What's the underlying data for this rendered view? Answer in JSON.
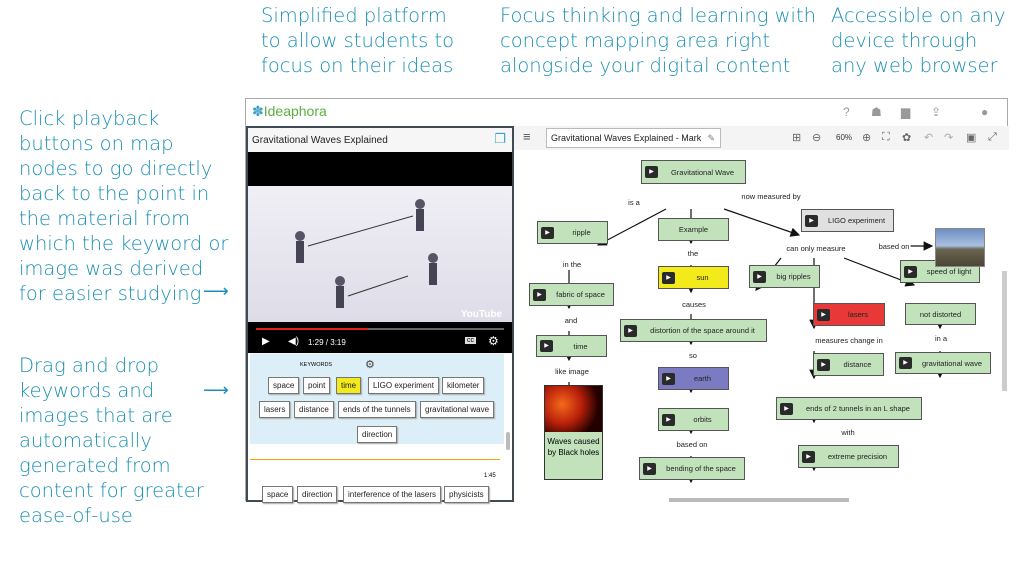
{
  "captions": {
    "top": [
      [
        "Simplified platform",
        "to allow students to",
        "focus on their ideas"
      ],
      [
        "Focus thinking and learning with",
        "concept mapping area right",
        "alongside your digital content"
      ],
      [
        "Accessible on any",
        "device through",
        "any web browser"
      ]
    ],
    "left": [
      [
        "Click playback",
        "buttons on map",
        "nodes to go directly",
        "back to the point in",
        "the material from",
        "which the keyword or",
        "image was derived",
        "for easier studying"
      ],
      [
        "Drag and drop",
        "keywords and",
        "images that are",
        "automatically",
        "generated from",
        "content for greater",
        "ease-of-use"
      ]
    ]
  },
  "app": {
    "logo": "Ideaphora",
    "top_icons": [
      "help-icon",
      "hierarchy-icon",
      "folder-icon",
      "upload-icon",
      "user-icon"
    ]
  },
  "left_panel": {
    "title": "Gravitational Waves Explained",
    "video": {
      "time": "1:29 / 3:19",
      "progress_percent": 45,
      "watermark": "YouTube"
    },
    "keywords_label": "KEYWORDS",
    "keywords": [
      "space",
      "point",
      "time",
      "LIGO experiment",
      "kilometer",
      "lasers",
      "distance",
      "ends of the tunnels",
      "gravitational wave",
      "direction"
    ],
    "highlighted_keyword": "time",
    "timestamp": "1:45",
    "keywords2": [
      "space",
      "direction",
      "interference of the lasers",
      "physicists"
    ]
  },
  "map": {
    "title": "Gravitational Waves Explained - Mark",
    "zoom": "60%",
    "nodes": {
      "gw": "Gravitational Wave",
      "ripple": "ripple",
      "example": "Example",
      "sun": "sun",
      "fabric": "fabric of space",
      "distortion": "distortion of the space around it",
      "time": "time",
      "earth": "earth",
      "orbits": "orbits",
      "bending": "bending of the space",
      "waves": "Waves caused by Black holes",
      "ligo": "LIGO experiment",
      "big": "big ripples",
      "speed": "speed of light",
      "lasers": "lasers",
      "notdist": "not distorted",
      "distance": "distance",
      "gw2": "gravitational wave",
      "ends": "ends of 2 tunnels in an L shape",
      "precision": "extreme precision"
    },
    "edges": {
      "isa": "is a",
      "now": "now measured by",
      "the": "the",
      "inthe": "in the",
      "causes": "causes",
      "and": "and",
      "so": "so",
      "like": "like image",
      "basedon1": "based on",
      "canonly": "can only measure",
      "basedon2": "based on",
      "measures": "measures change in",
      "ina": "in a",
      "with": "with"
    },
    "colors": {
      "node": "#c2e2bc",
      "sun": "#f2ea1a",
      "earth": "#7b7bc4",
      "lasers": "#e83838",
      "ligo": "#e0e0e0"
    }
  }
}
